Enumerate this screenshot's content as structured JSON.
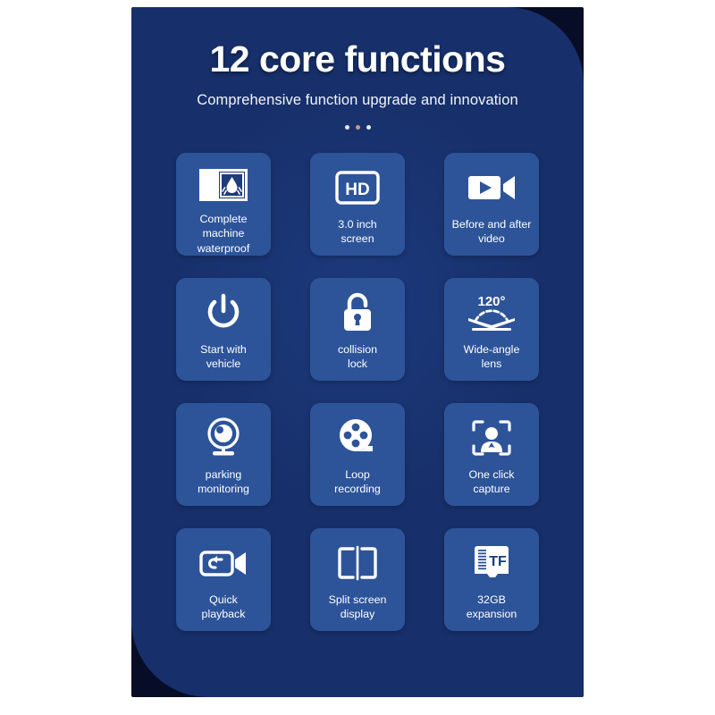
{
  "header": {
    "title": "12 core functions",
    "subtitle": "Comprehensive function upgrade and innovation",
    "dots_count": 3
  },
  "colors": {
    "page_background": "#ffffff",
    "panel_background": "#17306b",
    "panel_shadow": "#070d26",
    "card_background": "#2d5499",
    "icon_color": "#ffffff",
    "text_color": "#ffffff",
    "accent_dot": "#c79d86"
  },
  "features": [
    {
      "icon": "waterproof-icon",
      "label": "Complete machine\nwaterproof"
    },
    {
      "icon": "hd-screen-icon",
      "label": "3.0 inch\nscreen"
    },
    {
      "icon": "video-camera-icon",
      "label": "Before and after\nvideo"
    },
    {
      "icon": "power-button-icon",
      "label": "Start with\nvehicle"
    },
    {
      "icon": "padlock-icon",
      "label": "collision\nlock"
    },
    {
      "icon": "wide-angle-lens-icon",
      "label": "Wide-angle\nlens",
      "badge": "120°"
    },
    {
      "icon": "webcam-icon",
      "label": "parking\nmonitoring"
    },
    {
      "icon": "film-reel-icon",
      "label": "Loop\nrecording"
    },
    {
      "icon": "face-capture-icon",
      "label": "One click\ncapture"
    },
    {
      "icon": "playback-camera-icon",
      "label": "Quick\nplayback"
    },
    {
      "icon": "split-screen-icon",
      "label": "Split screen\ndisplay"
    },
    {
      "icon": "tf-card-icon",
      "label": "32GB\nexpansion",
      "badge": "TF"
    }
  ]
}
